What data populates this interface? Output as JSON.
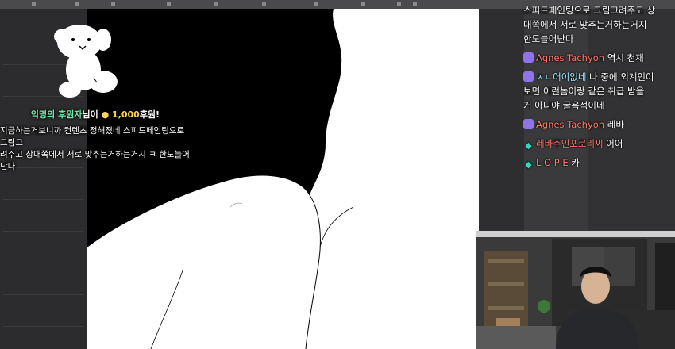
{
  "donation": {
    "donor": "익명의 후원자",
    "suffix": "님이",
    "amount": "1,000",
    "amount_suffix": "후원!",
    "message_line1": "지금하는거보니까 컨텐츠 정해졌네 스피드페인팅으로 그림그",
    "message_line2": "려주고 상대쪽에서 서로 맞추는거하는거지 ㅋ 한도늘어난다"
  },
  "chat": {
    "partial_line1": "스피드페인팅으로 그림그려주고 상",
    "partial_line2": "대쪽에서 서로 맞추는거하는거지",
    "partial_line3": "한도늘어난다",
    "messages": [
      {
        "user": "Agnes Tachyon",
        "user_color": "#ff7b6b",
        "badge": "mod",
        "text": "역시 천재"
      },
      {
        "user": "ㅈㄴ어이없네",
        "user_color": "#9ee8ff",
        "badge": "mod",
        "text": "나 중에 외계인이 보면 이런놈이랑 같은 취급 받을 거 아니야 굴욕적이네"
      },
      {
        "user": "Agnes Tachyon",
        "user_color": "#ff7b6b",
        "badge": "mod",
        "text": "레바"
      },
      {
        "user": "레바주인포로리씨",
        "user_color": "#ff7b6b",
        "badge": "gem",
        "text": "어어"
      },
      {
        "user": "L O P E",
        "user_color": "#ff7b6b",
        "badge": "gem",
        "text": "카"
      }
    ]
  },
  "colors": {
    "canvas_black": "#000000",
    "skin_white": "#ffffff",
    "chat_text": "#ffffff",
    "donor": "#6fe5a5",
    "amount": "#ffd25a"
  }
}
